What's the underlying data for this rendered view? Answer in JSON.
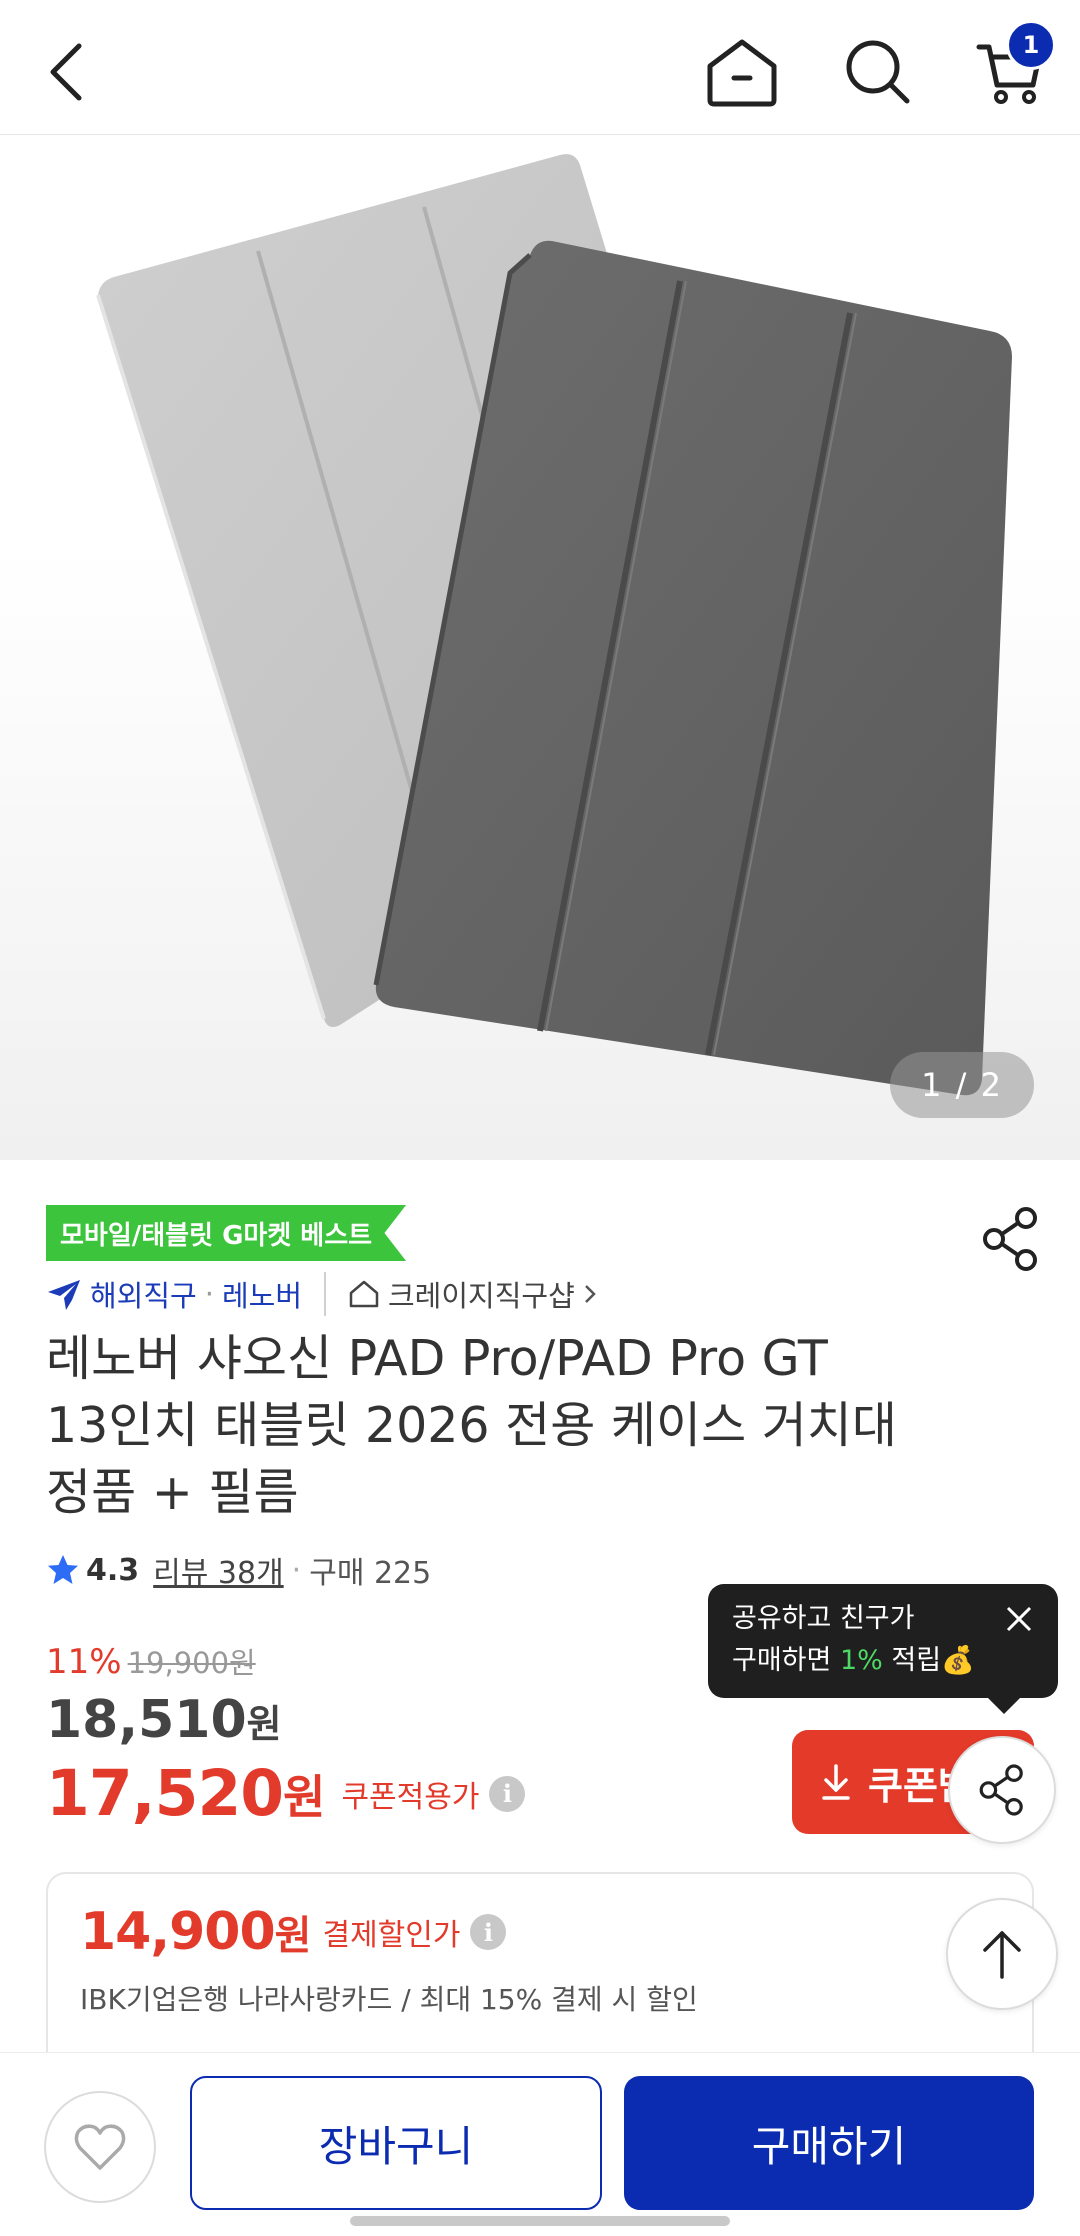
{
  "header": {
    "cart_count": "1"
  },
  "gallery": {
    "counter": "1 / 2"
  },
  "product": {
    "best_badge": "모바일/태블릿 G마켓 베스트",
    "shipping_type": "해외직구",
    "brand": "레노버",
    "shop": "크레이지직구샵",
    "title_lines": [
      "레노버 샤오신 PAD Pro/PAD Pro GT",
      "13인치 태블릿 2026 전용 케이스 거치대",
      "정품 + 필름"
    ],
    "rating": "4.3",
    "review_label": "리뷰 38개",
    "purchase_label": "구매 225",
    "discount_rate": "11%",
    "original_price": "19,900원",
    "price_number": "18,510",
    "price_unit": "원",
    "coupon_price_number": "17,520",
    "coupon_price_unit": "원",
    "coupon_price_label": "쿠폰적용가",
    "coupon_button_label": "쿠폰받",
    "payment_discount": {
      "amount_number": "14,900",
      "amount_unit": "원",
      "label": "결제할인가",
      "description": "IBK기업은행 나라사랑카드 / 최대 15% 결제 시 할인"
    }
  },
  "tooltip": {
    "line1": "공유하고 친구가",
    "line2_prefix": "구매하면 ",
    "line2_highlight": "1%",
    "line2_suffix": " 적립",
    "emoji": "💰"
  },
  "bottom_bar": {
    "cart_label": "장바구니",
    "buy_label": "구매하기"
  },
  "colors": {
    "brand_blue": "#0b2bb0",
    "sale_red": "#e23b2b",
    "best_green": "#3cc43c"
  }
}
